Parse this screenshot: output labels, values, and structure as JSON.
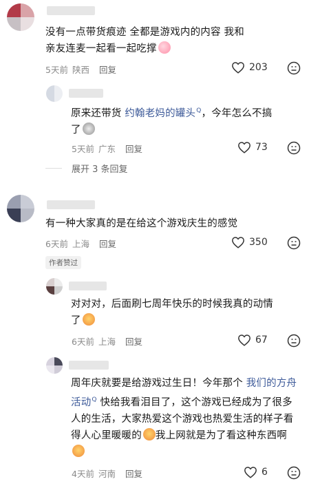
{
  "comments": [
    {
      "text_prefix": "没有一点带货痕迹 全都是游戏内的内容 我和亲友连麦一起看一起吃撑",
      "time": "5天前",
      "location": "陕西",
      "reply": "回复",
      "likes": "203",
      "replies": [
        {
          "text_1": "原来还带货 ",
          "link": "约翰老妈的罐头",
          "text_2": "，今年怎么不搞了",
          "time": "5天前",
          "location": "广东",
          "reply": "回复",
          "likes": "73"
        }
      ],
      "expand": "展开 3 条回复"
    },
    {
      "text": "有一种大家真的是在给这个游戏庆生的感觉",
      "time": "6天前",
      "location": "上海",
      "reply": "回复",
      "likes": "350",
      "badge": "作者赞过",
      "replies": [
        {
          "text": "对对对，后面刷七周年快乐的时候我真的动情了",
          "time": "6天前",
          "location": "上海",
          "reply": "回复",
          "likes": "67"
        },
        {
          "text_1": "周年庆就要是给游戏过生日！今年那个 ",
          "link": "我们的方舟活动",
          "text_2": " 快给我看泪目了，这个游戏已经成为了很多人的生活，大家热爱这个游戏也热爱生活的样子看得人心里暖暖的",
          "text_3": "我上网就是为了看这种东西啊",
          "time": "4天前",
          "location": "河南",
          "reply": "回复",
          "likes": "6"
        }
      ]
    }
  ],
  "icons": {
    "like": "heart-outline-icon",
    "dislike": "dislike-face-icon",
    "search": "search-superscript-icon"
  },
  "colors": {
    "link": "#3d5a99",
    "meta": "#8a8a8a"
  }
}
